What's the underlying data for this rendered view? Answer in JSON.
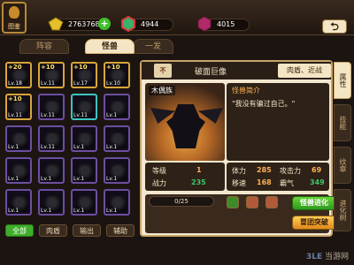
{
  "player": {
    "avatar_label": "图鉴"
  },
  "resources": [
    {
      "name": "gold",
      "icon": "gold-coin-icon",
      "value": "27637685",
      "color": "#e4c02a"
    },
    {
      "name": "red-crystal",
      "icon": "red-gem-icon",
      "value": "4944",
      "color": "#d83a3a"
    },
    {
      "name": "purple-crystal",
      "icon": "purple-gem-icon",
      "value": "4015",
      "color": "#b02a6a"
    }
  ],
  "tabs": [
    {
      "label": "阵容"
    },
    {
      "label": "怪兽"
    },
    {
      "label": "图鉴"
    }
  ],
  "tab_second": "怪兽",
  "tab_third": "一发",
  "filters": [
    {
      "label": "全部",
      "active": true
    },
    {
      "label": "肉盾",
      "active": false
    },
    {
      "label": "输出",
      "active": false
    },
    {
      "label": "辅助",
      "active": false
    }
  ],
  "units": [
    {
      "plus": "+20",
      "lv": "Lv.18",
      "frame": "gold"
    },
    {
      "plus": "+10",
      "lv": "Lv.11",
      "frame": "gold"
    },
    {
      "plus": "+10",
      "lv": "Lv.17",
      "frame": "gold"
    },
    {
      "plus": "+10",
      "lv": "Lv.10",
      "frame": "gold"
    },
    {
      "plus": "+10",
      "lv": "Lv.11",
      "frame": "gold"
    },
    {
      "plus": "",
      "lv": "Lv.11",
      "frame": "purple"
    },
    {
      "plus": "",
      "lv": "Lv.11",
      "frame": "teal"
    },
    {
      "plus": "",
      "lv": "Lv.1",
      "frame": "purple"
    },
    {
      "plus": "",
      "lv": "Lv.1",
      "frame": "purple"
    },
    {
      "plus": "",
      "lv": "Lv.11",
      "frame": "purple"
    },
    {
      "plus": "",
      "lv": "Lv.1",
      "frame": "purple"
    },
    {
      "plus": "",
      "lv": "Lv.1",
      "frame": "purple"
    },
    {
      "plus": "",
      "lv": "Lv.1",
      "frame": "purple"
    },
    {
      "plus": "",
      "lv": "Lv.1",
      "frame": "purple"
    },
    {
      "plus": "",
      "lv": "Lv.1",
      "frame": "purple"
    },
    {
      "plus": "",
      "lv": "Lv.1",
      "frame": "purple"
    },
    {
      "plus": "",
      "lv": "Lv.1",
      "frame": "purple"
    },
    {
      "plus": "",
      "lv": "Lv.1",
      "frame": "purple"
    },
    {
      "plus": "",
      "lv": "Lv.1",
      "frame": "purple"
    },
    {
      "plus": "",
      "lv": "Lv.1",
      "frame": "purple"
    }
  ],
  "unit_detail": {
    "stars": "不",
    "name": "破面巨像",
    "type": "肉盾、近战",
    "portrait_name": "木偶族",
    "intro_title": "怪兽简介",
    "intro_text": "\"我没有骗过自己。\"",
    "stats_left": [
      {
        "k": "等级",
        "v": "1"
      },
      {
        "k": "战力",
        "v": "235"
      }
    ],
    "stats_right": [
      {
        "k": "体力",
        "v": "285",
        "k2": "攻击力",
        "v2": "69"
      },
      {
        "k": "移速",
        "v": "168",
        "k2": "霸气",
        "v2": "349"
      }
    ],
    "evolve_progress": "0/25",
    "evolve_button": "怪兽进化",
    "breakthrough_button": "冒团突破"
  },
  "side_tabs": [
    {
      "label": "属性",
      "active": true
    },
    {
      "label": "技能",
      "active": false
    },
    {
      "label": "纹章",
      "active": false
    },
    {
      "label": "进化树",
      "active": false
    }
  ],
  "watermark": {
    "part1": "3LE",
    "part2": "当游网"
  }
}
